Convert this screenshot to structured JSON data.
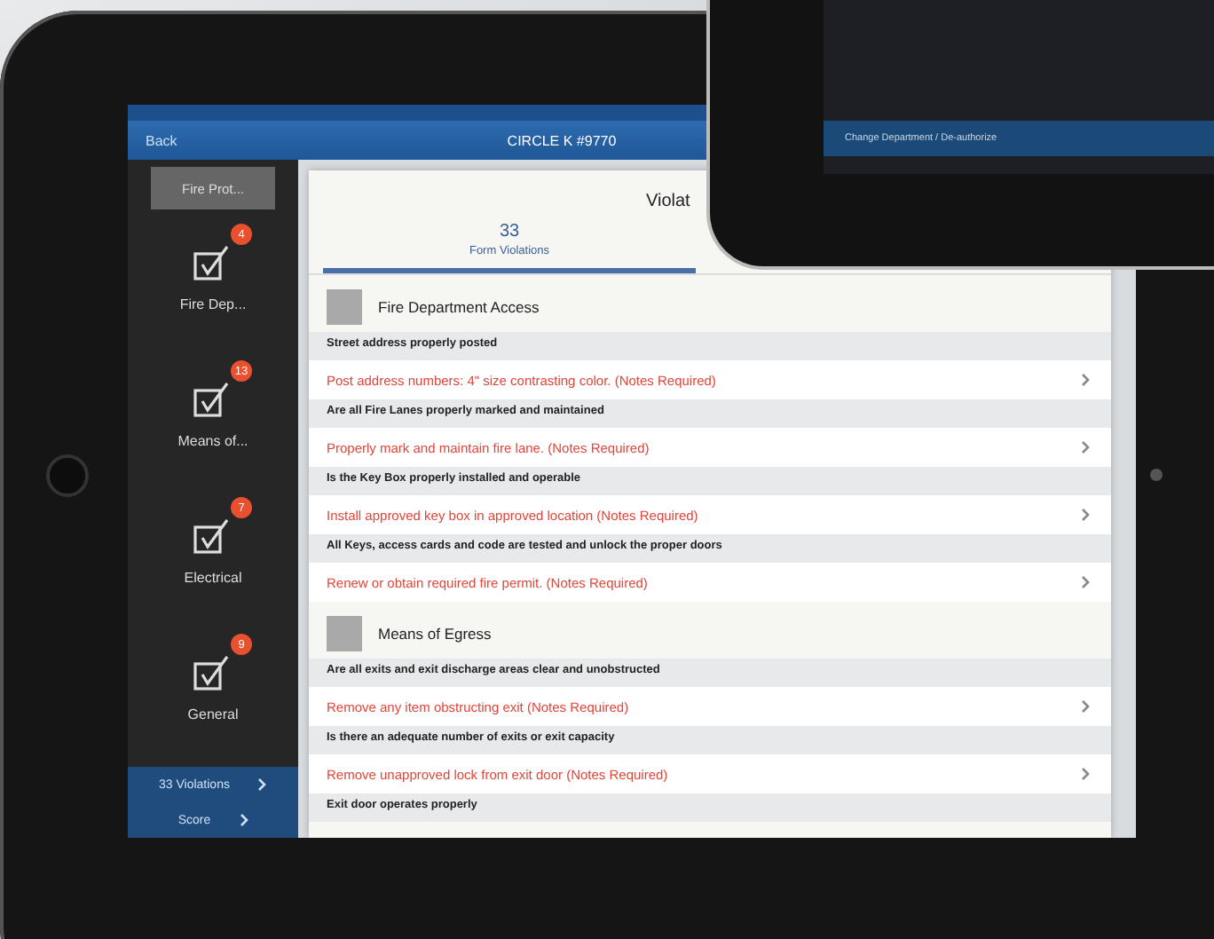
{
  "nav_bar": {
    "back": "Back",
    "title": "CIRCLE K #9770"
  },
  "sidebar": {
    "top_button": "Fire Prot...",
    "items": [
      {
        "label": "Fire Dep...",
        "badge": "4"
      },
      {
        "label": "Means of...",
        "badge": "13"
      },
      {
        "label": "Electrical",
        "badge": "7"
      },
      {
        "label": "General",
        "badge": "9"
      }
    ],
    "footer": [
      {
        "label": "33 Violations"
      },
      {
        "label": "Score"
      }
    ]
  },
  "panel": {
    "title": "Violat",
    "tabs": [
      {
        "count": "33",
        "label": "Form Violations",
        "selected": true
      }
    ]
  },
  "sections": [
    {
      "title": "Fire Department Access",
      "items": [
        {
          "question": "Street address properly posted",
          "violation": "Post address numbers: 4\" size contrasting color. (Notes Required)"
        },
        {
          "question": "Are all Fire Lanes properly marked and maintained",
          "violation": "Properly mark and maintain fire lane. (Notes Required)"
        },
        {
          "question": "Is the Key Box properly installed and operable",
          "violation": "Install approved key box in approved location (Notes Required)"
        },
        {
          "question": "All Keys, access cards and code are tested and unlock the proper doors",
          "violation": "Renew or obtain required fire permit. (Notes Required)"
        }
      ]
    },
    {
      "title": "Means of Egress",
      "items": [
        {
          "question": "Are all exits and exit discharge areas clear and unobstructed",
          "violation": "Remove any item obstructing exit (Notes Required)"
        },
        {
          "question": "Is there an adequate number of exits or exit capacity",
          "violation": "Remove unapproved lock from exit door (Notes Required)"
        },
        {
          "question": "Exit door operates properly"
        }
      ]
    }
  ],
  "overlay_device": {
    "bar": "Change Department / De-authorize"
  }
}
